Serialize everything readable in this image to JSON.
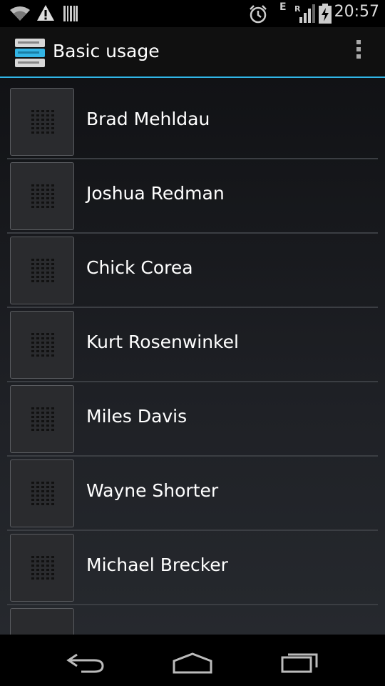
{
  "status_bar": {
    "icons": [
      "wifi-icon",
      "warning-icon",
      "barcode-icon",
      "alarm-icon",
      "signal-icon",
      "battery-icon"
    ],
    "network_label": "E",
    "roaming_label": "R",
    "time": "20:57"
  },
  "action_bar": {
    "title": "Basic usage",
    "accent_color": "#33b5e5"
  },
  "list": {
    "items": [
      {
        "label": "Brad Mehldau"
      },
      {
        "label": "Joshua Redman"
      },
      {
        "label": "Chick Corea"
      },
      {
        "label": "Kurt Rosenwinkel"
      },
      {
        "label": "Miles Davis"
      },
      {
        "label": "Wayne Shorter"
      },
      {
        "label": "Michael Brecker"
      },
      {
        "label": ""
      }
    ]
  },
  "nav_bar": {
    "buttons": [
      "back-icon",
      "home-icon",
      "recents-icon"
    ]
  }
}
